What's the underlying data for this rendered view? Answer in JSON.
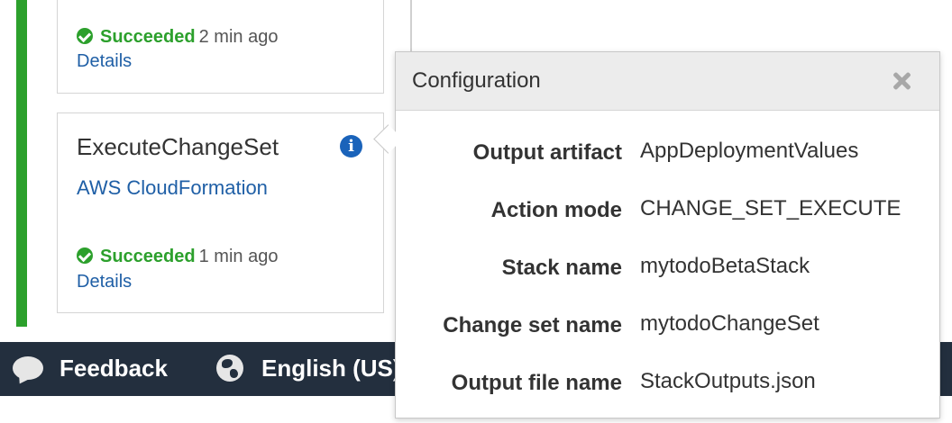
{
  "stages": {
    "top_card": {
      "status": "Succeeded",
      "time": "2 min ago",
      "details_label": "Details"
    },
    "execute_card": {
      "action_name": "ExecuteChangeSet",
      "provider": "AWS CloudFormation",
      "status": "Succeeded",
      "time": "1 min ago",
      "details_label": "Details",
      "info_icon": "i"
    }
  },
  "footer": {
    "feedback_label": "Feedback",
    "language_label": "English (US)"
  },
  "popover": {
    "title": "Configuration",
    "rows": [
      {
        "label": "Output artifact",
        "value": "AppDeploymentValues"
      },
      {
        "label": "Action mode",
        "value": "CHANGE_SET_EXECUTE"
      },
      {
        "label": "Stack name",
        "value": "mytodoBetaStack"
      },
      {
        "label": "Change set name",
        "value": "mytodoChangeSet"
      },
      {
        "label": "Output file name",
        "value": "StackOutputs.json"
      }
    ]
  },
  "colors": {
    "success": "#2ca02c",
    "link": "#1f5fa6",
    "footer_bg": "#232f3e",
    "info_icon": "#1a63ba"
  }
}
